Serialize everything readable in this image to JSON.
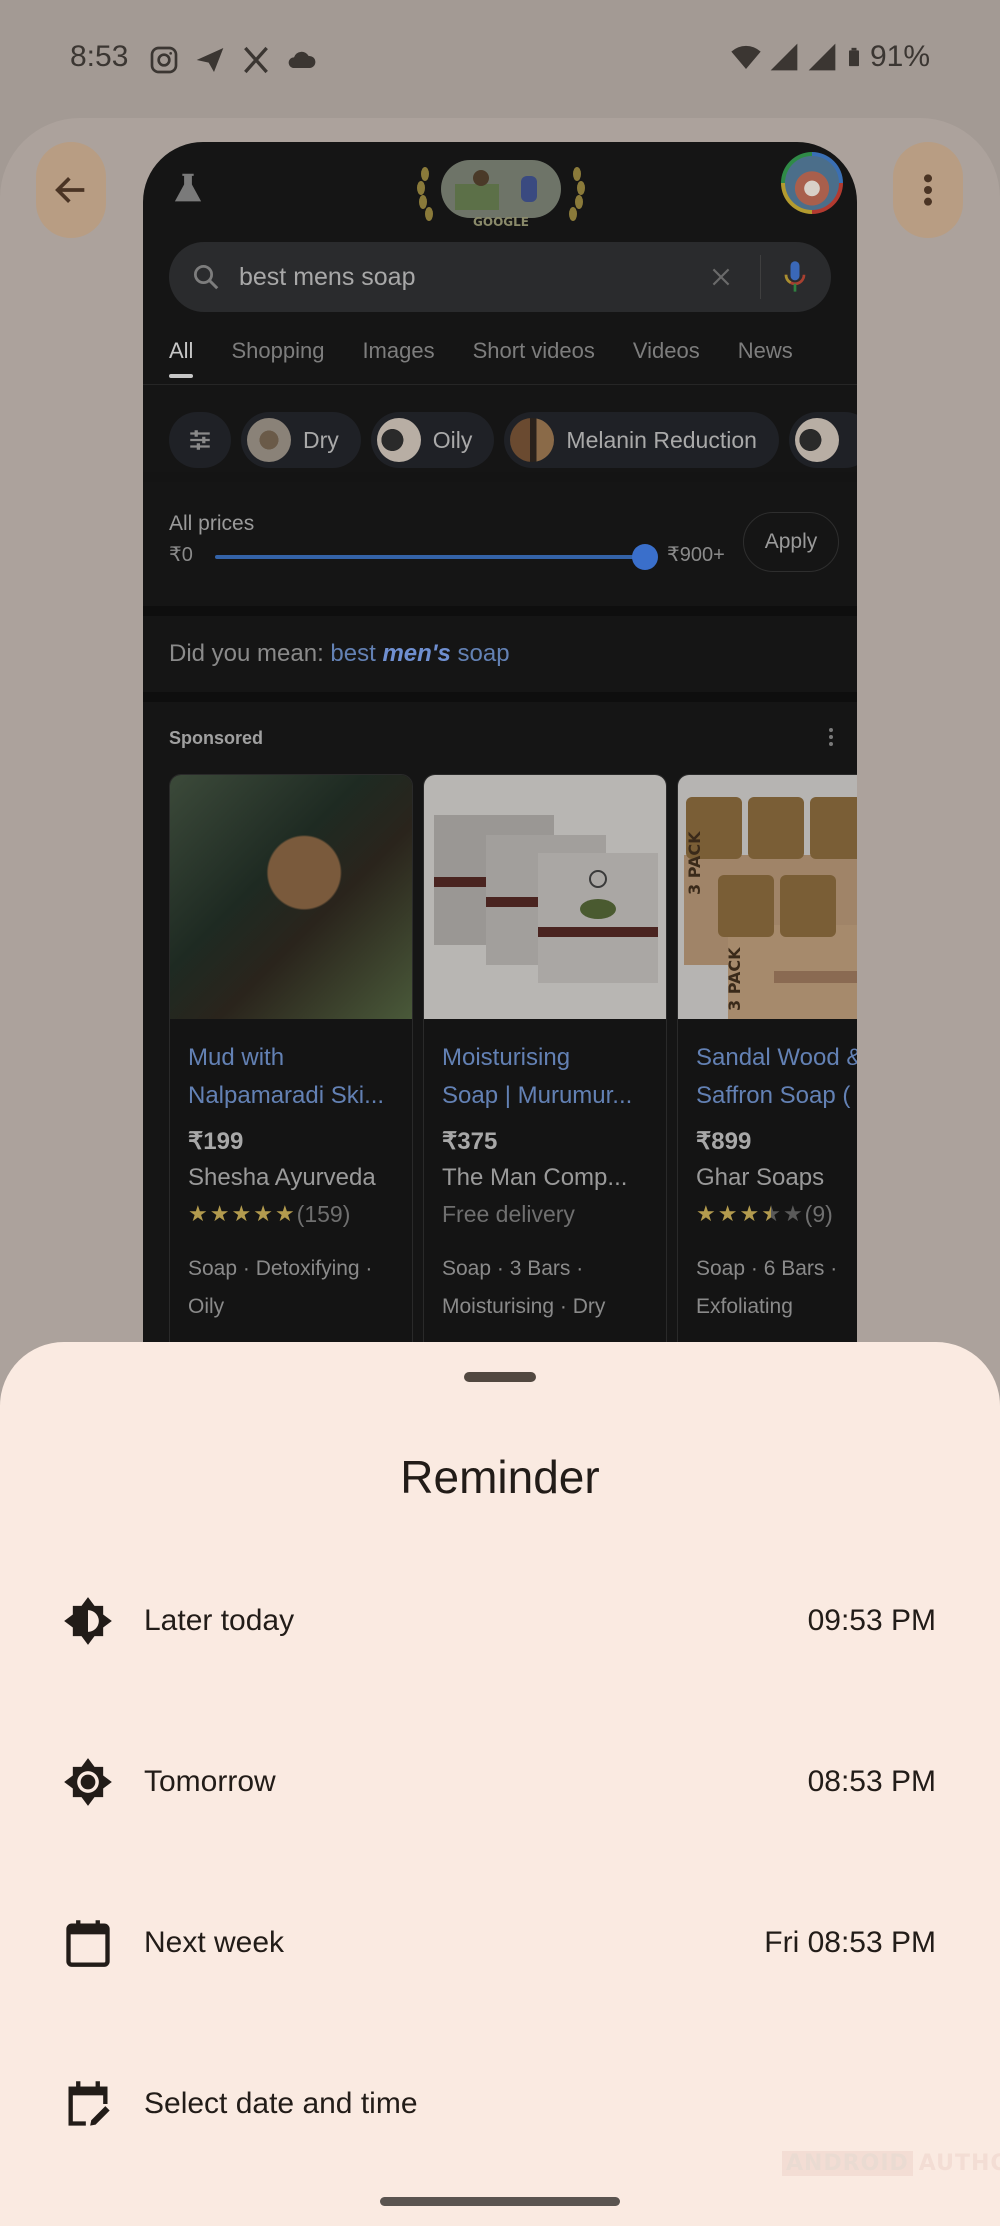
{
  "status_bar": {
    "time": "8:53",
    "left_icons": [
      "instagram-icon",
      "telegram-icon",
      "x-icon",
      "cloud-icon"
    ],
    "right_icons": [
      "wifi-icon",
      "signal-icon",
      "signal-icon",
      "battery-icon"
    ],
    "battery": "91%"
  },
  "toolbar": {
    "back_icon": "arrow-left-icon",
    "more_icon": "more-vertical-icon"
  },
  "browser": {
    "search": {
      "query": "best mens soap",
      "icons": [
        "search-icon",
        "clear-icon",
        "mic-icon"
      ]
    },
    "tabs": [
      {
        "label": "All",
        "active": true
      },
      {
        "label": "Shopping",
        "active": false
      },
      {
        "label": "Images",
        "active": false
      },
      {
        "label": "Short videos",
        "active": false
      },
      {
        "label": "Videos",
        "active": false
      },
      {
        "label": "News",
        "active": false
      }
    ],
    "chips": [
      {
        "label": "Dry"
      },
      {
        "label": "Oily"
      },
      {
        "label": "Melanin Reduction"
      },
      {
        "label": ""
      }
    ],
    "price_filter": {
      "label": "All prices",
      "min": "₹0",
      "max": "₹900+",
      "slider_value_fraction": 1.0,
      "apply_label": "Apply"
    },
    "did_you_mean": {
      "prefix": "Did you mean: ",
      "link_before": "best ",
      "link_em": "men's",
      "link_after": " soap"
    },
    "sponsored_label": "Sponsored",
    "products": [
      {
        "title_line1": "Mud with",
        "title_line2": "Nalpamaradi Ski...",
        "price": "₹199",
        "seller": "Shesha Ayurveda",
        "rating": 5,
        "reviews": "(159)",
        "extra": "",
        "tags_line1": "Soap · Detoxifying ·",
        "tags_line2": "Oily"
      },
      {
        "title_line1": "Moisturising",
        "title_line2": "Soap | Murumur...",
        "price": "₹375",
        "seller": "The Man Comp...",
        "rating": null,
        "reviews": "",
        "extra": "Free delivery",
        "tags_line1": "Soap · 3 Bars ·",
        "tags_line2": "Moisturising · Dry"
      },
      {
        "title_line1": "Sandal Wood &",
        "title_line2": "Saffron Soap (",
        "price": "₹899",
        "seller": "Ghar Soaps",
        "rating": 3.5,
        "reviews": "(9)",
        "extra": "",
        "tags_line1": "Soap · 6 Bars ·",
        "tags_line2": "Exfoliating"
      }
    ]
  },
  "reminder_sheet": {
    "title": "Reminder",
    "options": [
      {
        "label": "Later today",
        "time": "09:53 PM",
        "icon": "brightness-half-icon"
      },
      {
        "label": "Tomorrow",
        "time": "08:53 PM",
        "icon": "brightness-icon"
      },
      {
        "label": "Next week",
        "time": "Fri 08:53 PM",
        "icon": "calendar-icon"
      },
      {
        "label": "Select date and time",
        "time": "",
        "icon": "calendar-edit-icon"
      }
    ]
  },
  "watermark": {
    "part1": "ANDROID",
    "part2": "AUTHORITY"
  },
  "colors": {
    "sheet_bg": "#faeae1",
    "scrim": "#a39a94",
    "browser_bg": "#151515",
    "link": "#6381b4",
    "slider": "#3a6fcb",
    "star": "#b39b4e"
  }
}
